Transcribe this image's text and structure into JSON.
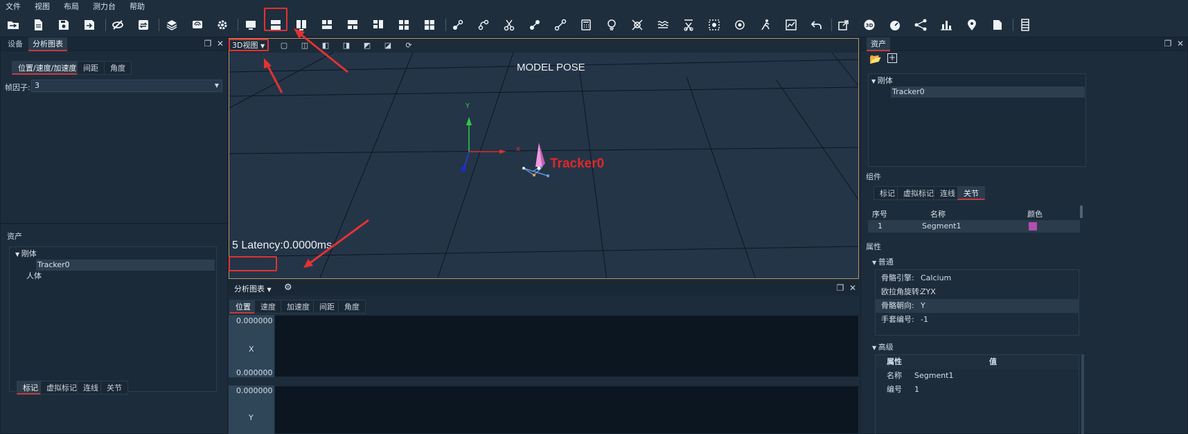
{
  "menu": [
    "文件",
    "视图",
    "布局",
    "测力台",
    "帮助"
  ],
  "toolbar_icons": [
    "open-folder-icon",
    "new-file-icon",
    "save-icon",
    "save-as-icon",
    "hide-icon",
    "refresh-icon",
    "layers-icon",
    "camera-icon",
    "settings-icon",
    "layout-single-icon",
    "layout-split-horizontal-icon",
    "layout-split-vertical-icon",
    "layout-top-two-icon",
    "layout-bottom-two-icon",
    "layout-left-two-icon",
    "layout-four-icon",
    "marker-link-icon",
    "marker-curve-icon",
    "cut-icon",
    "marker-edit-icon",
    "marker-line-icon",
    "calculator-icon",
    "bulb-icon",
    "remove-marker-icon",
    "wave-icon",
    "filter-cut-icon",
    "select-region-icon",
    "orbit-icon",
    "run-icon",
    "chart-line-icon",
    "undo-icon",
    "export-icon",
    "3d-icon",
    "speedometer-icon",
    "skeleton-link-icon",
    "bar-chart-icon",
    "location-pin-icon",
    "document-icon",
    "list-icon"
  ],
  "left_top": {
    "tabs": [
      "设备",
      "分析图表"
    ],
    "subtabs": [
      "位置/速度/加速度",
      "间距",
      "角度"
    ],
    "frame_factor_label": "帧因子:",
    "frame_factor_value": "3"
  },
  "left_bottom": {
    "title": "资产",
    "tree": {
      "rigid": "刚体",
      "tracker": "Tracker0",
      "human": "人体"
    },
    "tabs": [
      "标记",
      "虚拟标记",
      "连线",
      "关节"
    ]
  },
  "view3d": {
    "dropdown": "3D视图",
    "caption": "MODEL POSE",
    "axis_y": "Y",
    "axis_x": "x",
    "tracker_label": "Tracker0",
    "latency": "5 Latency:0.0000ms"
  },
  "chart": {
    "dropdown": "分析图表",
    "tabs": [
      "位置",
      "速度",
      "加速度",
      "间距",
      "角度"
    ],
    "x_top": "0.000000",
    "x_label": "X",
    "x_bottom": "0.000000",
    "y_top": "0.000000",
    "y_label": "Y"
  },
  "right": {
    "title": "资产",
    "tree": {
      "rigid": "刚体",
      "tracker": "Tracker0"
    },
    "component_label": "组件",
    "component_tabs": [
      "标记",
      "虚拟标记",
      "连线",
      "关节"
    ],
    "table_head": {
      "index": "序号",
      "name": "名称",
      "color": "颜色"
    },
    "table_row": {
      "index": "1",
      "name": "Segment1",
      "color": "#b04fb0"
    },
    "props_label": "属性",
    "general_label": "普通",
    "general": [
      {
        "k": "骨骼引擎:",
        "v": "Calcium"
      },
      {
        "k": "欧拉角旋转:",
        "v": "ZYX"
      },
      {
        "k": "骨骼朝向:",
        "v": "Y"
      },
      {
        "k": "手套编号:",
        "v": "-1"
      }
    ],
    "advanced_label": "高级",
    "adv_head": {
      "prop": "属性",
      "val": "值"
    },
    "advanced": [
      {
        "k": "名称",
        "v": "Segment1"
      },
      {
        "k": "编号",
        "v": "1"
      }
    ]
  }
}
